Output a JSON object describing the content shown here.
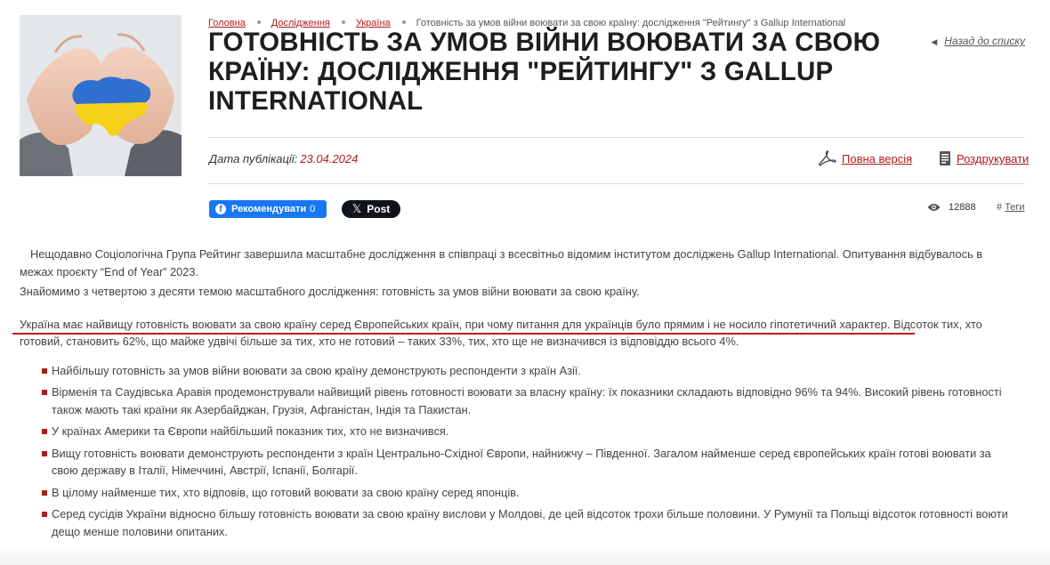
{
  "breadcrumb": {
    "items": [
      "Головна",
      "Дослідження",
      "Україна"
    ],
    "current": "Готовність за умов війни воювати за свою країну: дослідження \"Рейтингу\" з Gallup International"
  },
  "back_link": "Назад до списку",
  "title": "ГОТОВНІСТЬ ЗА УМОВ ВІЙНИ ВОЮВАТИ ЗА СВОЮ КРАЇНУ: ДОСЛІДЖЕННЯ \"РЕЙТИНГУ\" З GALLUP INTERNATIONAL",
  "meta": {
    "pub_label": "Дата публікації:",
    "pub_date": "23.04.2024",
    "full_version": "Повна версія",
    "print": "Роздрукувати"
  },
  "social": {
    "fb_label": "Рекомендувати",
    "fb_count": "0",
    "x_label": "Post"
  },
  "stats": {
    "views": "12888",
    "tags_hash": "#",
    "tags_label": "Теги"
  },
  "content": {
    "p1": "Нещодавно Соціологічна Група Рейтинг завершила масштабне дослідження в співпраці з всесвітньо відомим інститутом досліджень Gallup International. Опитування відбувалось в межах проєкту “End of Year” 2023.",
    "p2": "Знайомимо з четвертою з десяти темою масштабного дослідження:  готовність за умов війни воювати за свою країну.",
    "p3": "Україна має найвищу готовність воювати за свою країну серед Європейських країн, при чому  питання для українців було прямим і не носило гіпотетичний характер. Відсоток тих, хто готовий, становить 62%, що майже удвічі більше за тих, хто не готовий – таких 33%, тих, хто ще не визначився із відповіддю всього 4%.",
    "bullets": [
      "Найбільшу готовність за умов війни воювати за свою країну демонструють респонденти з країн Азії.",
      "Вірменія та Саудівська Аравія продемонстрували найвищий рівень готовності воювати за власну країну: їх показники складають відповідно 96% та 94%. Високий рівень готовності також мають такі країни як Азербайджан, Грузія, Афганістан, Індія та Пакистан.",
      "У країнах Америки та Європи найбільший показник тих, хто не визначився.",
      "Вищу готовність воювати демонструють респонденти з країн Центрально-Східної Європи, найнижчу – Південної. Загалом найменше серед європейських країн готові воювати за свою державу в Італії, Німеччині, Австрії, Іспанії, Болгарії.",
      "В цілому найменше тих, хто відповів, що готовий воювати за свою країну серед японців.",
      "Серед сусідів України відносно більшу готовність воювати за свою країну вислови у Молдові, де цей відсоток трохи більше половини. У Румунії та Польщі відсоток готовності воюти дещо менше половини опитаних."
    ]
  },
  "colors": {
    "accent": "#b01c1c",
    "underline": "#c8181e",
    "facebook": "#1877f2",
    "x": "#0f1419",
    "flag_blue": "#2f6fd0",
    "flag_yellow": "#f5d21a"
  },
  "icons": {
    "pdf": "pdf-icon",
    "print": "print-icon",
    "views": "eye-icon",
    "back": "triangle-left-icon"
  }
}
